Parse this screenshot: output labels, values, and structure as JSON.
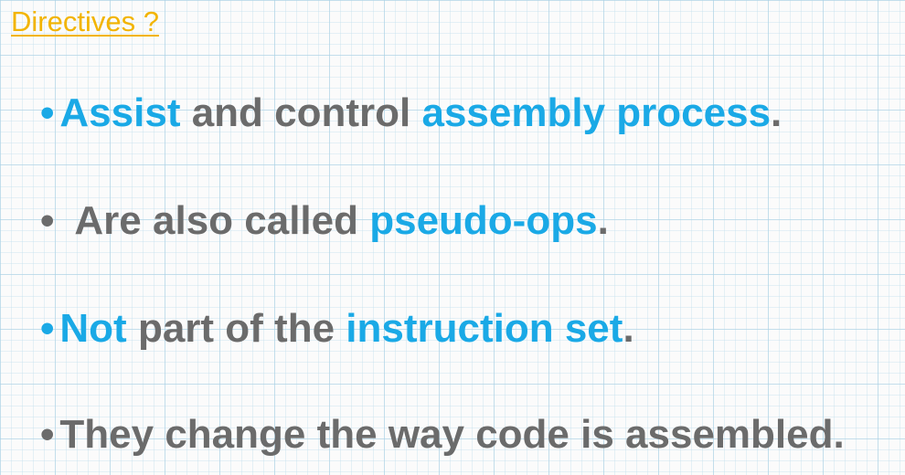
{
  "title": "Directives ?",
  "colors": {
    "title": "#f2b400",
    "emphasis": "#1aa9e6",
    "body": "#6b6b6b"
  },
  "bullet_glyph": "•",
  "bullets": [
    {
      "dot_color": "blue",
      "segments": [
        {
          "text": "Assist",
          "color": "blue"
        },
        {
          "text": " and control ",
          "color": "gray"
        },
        {
          "text": "assembly process",
          "color": "blue"
        },
        {
          "text": ".",
          "color": "gray"
        }
      ]
    },
    {
      "dot_color": "gray",
      "segments": [
        {
          "text": "Are also called ",
          "color": "gray"
        },
        {
          "text": "pseudo-ops",
          "color": "blue"
        },
        {
          "text": ".",
          "color": "gray"
        }
      ]
    },
    {
      "dot_color": "blue",
      "segments": [
        {
          "text": "Not",
          "color": "blue"
        },
        {
          "text": " part of the ",
          "color": "gray"
        },
        {
          "text": "instruction set",
          "color": "blue"
        },
        {
          "text": ".",
          "color": "gray"
        }
      ]
    },
    {
      "dot_color": "gray",
      "segments": [
        {
          "text": "They change the way code is assembled.",
          "color": "gray"
        }
      ]
    }
  ]
}
